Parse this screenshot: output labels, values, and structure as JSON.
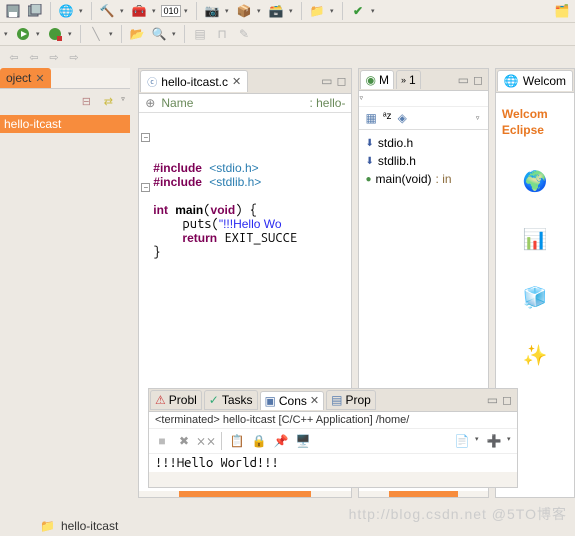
{
  "toolbar": {
    "icons": [
      "save",
      "save-all",
      "globe",
      "hammer",
      "toolbox",
      "binary",
      "camera",
      "package",
      "package2",
      "folder",
      "check",
      "green-run",
      "perspective"
    ]
  },
  "left": {
    "tab": "oject",
    "selected": "hello-itcast"
  },
  "editor": {
    "tab": "hello-itcast.c",
    "headerL": "Name",
    "headerR": ": hello-",
    "lines": [
      "",
      "#include <stdio.h>",
      "#include <stdlib.h>",
      "",
      "int main(void) {",
      "    puts(\"!!!Hello Wo",
      "    return EXIT_SUCCE",
      "}"
    ]
  },
  "outline": {
    "tab1": "M",
    "tab2": "1",
    "items": [
      {
        "icon": "inc",
        "label": "stdio.h"
      },
      {
        "icon": "inc",
        "label": "stdlib.h"
      },
      {
        "icon": "fn",
        "label": "main(void)",
        "type": ": in"
      }
    ]
  },
  "welcome": {
    "tab": "Welcom",
    "title1": "Welcom",
    "title2": "Eclipse"
  },
  "bottom": {
    "tabs": [
      "Probl",
      "Tasks",
      "Cons",
      "Prop"
    ],
    "activeIdx": 2,
    "path": "<terminated> hello-itcast [C/C++ Application] /home/",
    "output": "!!!Hello World!!!"
  },
  "status": {
    "text": "hello-itcast"
  },
  "watermark": "http://blog.csdn.net @5TO博客"
}
